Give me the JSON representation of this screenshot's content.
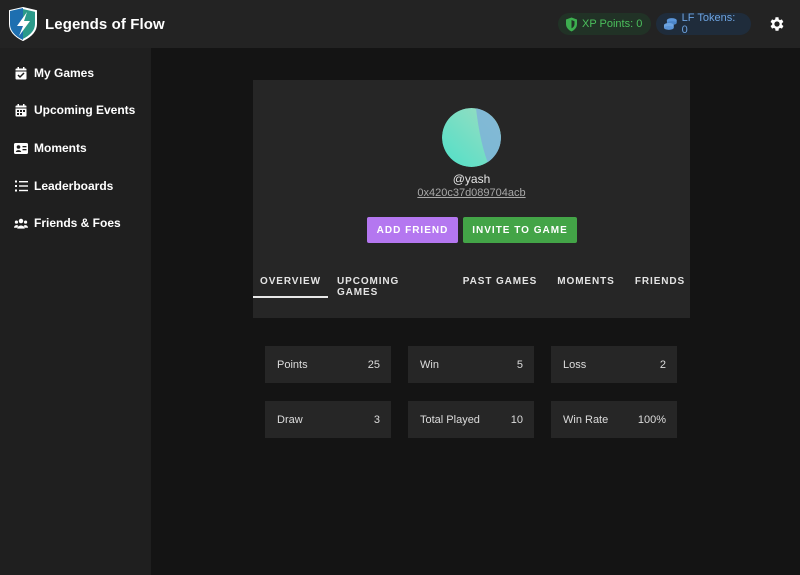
{
  "brand": {
    "title": "Legends of Flow",
    "logo_icon": "lightning-shield-logo"
  },
  "header": {
    "xp": {
      "label": "XP Points: 0",
      "icon": "shield-icon"
    },
    "tokens": {
      "label": "LF Tokens: 0",
      "icon": "coins-icon"
    },
    "settings_icon": "gear-icon"
  },
  "sidebar": {
    "items": [
      {
        "label": "My Games",
        "icon": "calendar-check-icon"
      },
      {
        "label": "Upcoming Events",
        "icon": "calendar-icon"
      },
      {
        "label": "Moments",
        "icon": "id-card-icon"
      },
      {
        "label": "Leaderboards",
        "icon": "list-ol-icon"
      },
      {
        "label": "Friends & Foes",
        "icon": "users-icon"
      }
    ]
  },
  "profile": {
    "username": "@yash",
    "address": "0x420c37d089704acb",
    "add_friend_label": "ADD FRIEND",
    "invite_label": "INVITE TO GAME",
    "tabs": [
      {
        "label": "OVERVIEW",
        "active": true
      },
      {
        "label": "UPCOMING GAMES",
        "active": false
      },
      {
        "label": "PAST GAMES",
        "active": false
      },
      {
        "label": "MOMENTS",
        "active": false
      },
      {
        "label": "FRIENDS",
        "active": false
      }
    ]
  },
  "stats": [
    {
      "label": "Points",
      "value": "25"
    },
    {
      "label": "Win",
      "value": "5"
    },
    {
      "label": "Loss",
      "value": "2"
    },
    {
      "label": "Draw",
      "value": "3"
    },
    {
      "label": "Total Played",
      "value": "10"
    },
    {
      "label": "Win Rate",
      "value": "100%"
    }
  ],
  "colors": {
    "add_friend": "#b477f0",
    "invite": "#43a447",
    "xp_text": "#4bbf5c",
    "tokens_text": "#6da3e0"
  }
}
